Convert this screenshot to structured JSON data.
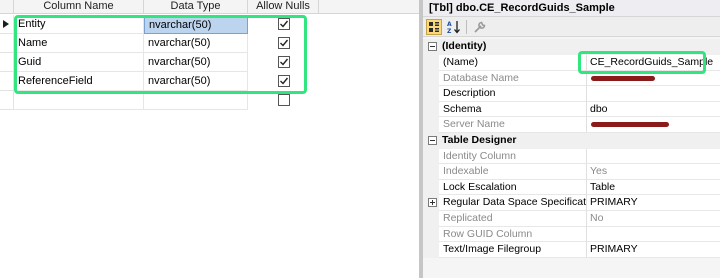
{
  "designer": {
    "columns": {
      "name_header": "Column Name",
      "type_header": "Data Type",
      "nulls_header": "Allow Nulls"
    },
    "rows": [
      {
        "name": "Entity",
        "type": "nvarchar(50)",
        "allow_nulls": true
      },
      {
        "name": "Name",
        "type": "nvarchar(50)",
        "allow_nulls": true
      },
      {
        "name": "Guid",
        "type": "nvarchar(50)",
        "allow_nulls": true
      },
      {
        "name": "ReferenceField",
        "type": "nvarchar(50)",
        "allow_nulls": true
      },
      {
        "name": "",
        "type": "",
        "allow_nulls": false
      }
    ],
    "highlight_color": "#31e67f",
    "selection_color": "#bcd4ee"
  },
  "properties": {
    "title": "[Tbl] dbo.CE_RecordGuids_Sample",
    "toolbar": {
      "categorized_icon": "categorized-icon",
      "alphabetical_icon": "sort-az-icon",
      "property_pages_icon": "wrench-icon"
    },
    "categories": [
      {
        "label": "(Identity)",
        "items": [
          {
            "name": "(Name)",
            "value": "CE_RecordGuids_Sample",
            "readonly": false
          },
          {
            "name": "Database Name",
            "value": "",
            "readonly": true
          },
          {
            "name": "Description",
            "value": "",
            "readonly": false
          },
          {
            "name": "Schema",
            "value": "dbo",
            "readonly": false
          },
          {
            "name": "Server Name",
            "value": "",
            "readonly": true
          }
        ]
      },
      {
        "label": "Table Designer",
        "items": [
          {
            "name": "Identity Column",
            "value": "",
            "readonly": true
          },
          {
            "name": "Indexable",
            "value": "Yes",
            "readonly": true
          },
          {
            "name": "Lock Escalation",
            "value": "Table",
            "readonly": false
          },
          {
            "name": "Regular Data Space Specification",
            "value": "PRIMARY",
            "readonly": false
          },
          {
            "name": "Replicated",
            "value": "No",
            "readonly": true
          },
          {
            "name": "Row GUID Column",
            "value": "",
            "readonly": true
          },
          {
            "name": "Text/Image Filegroup",
            "value": "PRIMARY",
            "readonly": false
          }
        ]
      }
    ],
    "redaction_color": "#8b1a1a"
  }
}
